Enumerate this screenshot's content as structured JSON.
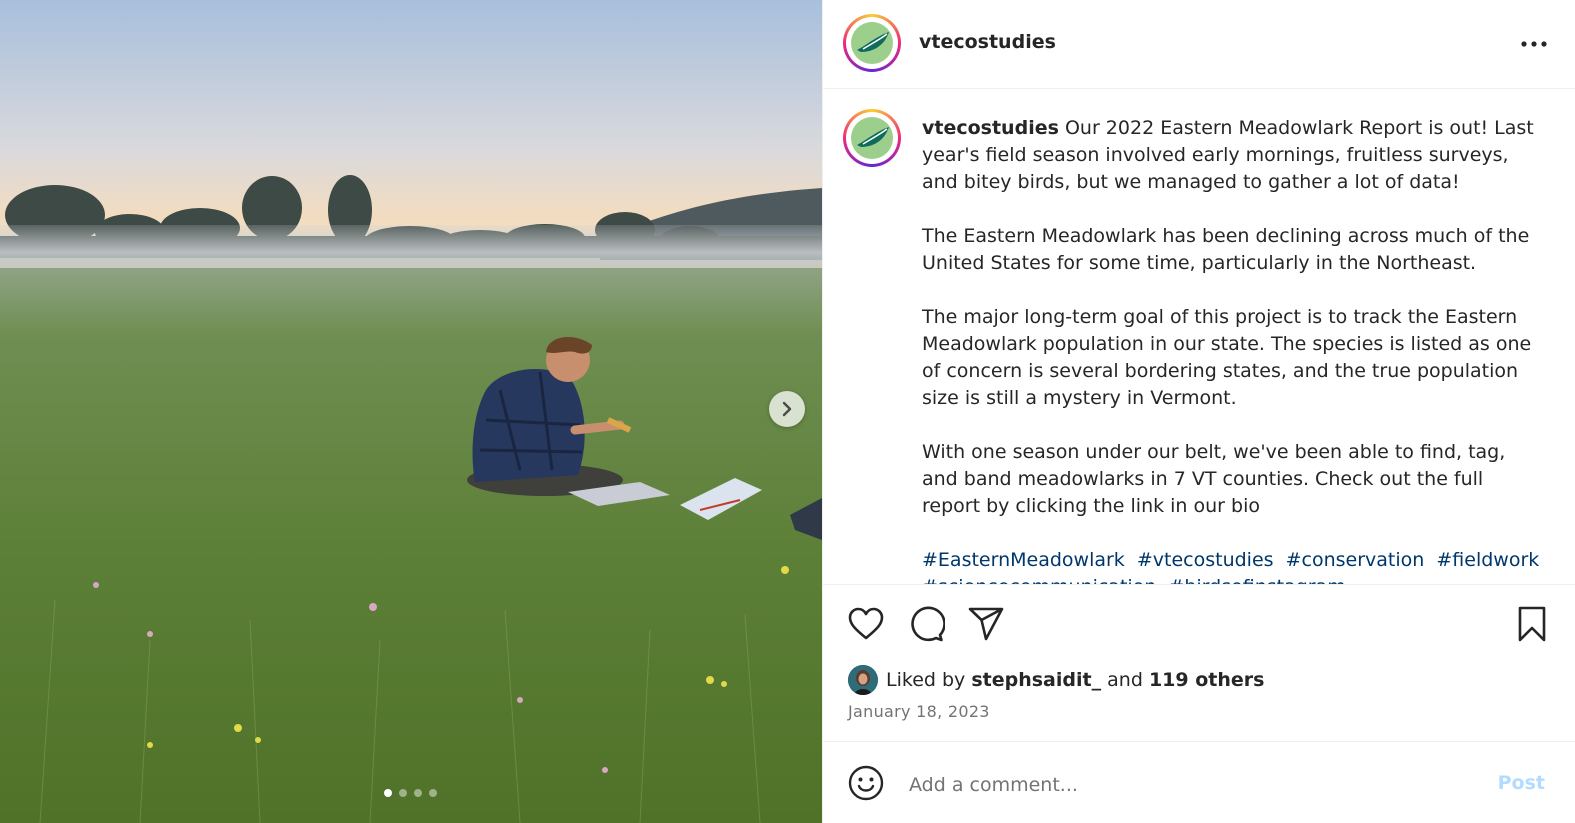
{
  "post": {
    "username": "vtecostudies",
    "caption": {
      "username": "vtecostudies",
      "paragraphs": [
        "Our 2022 Eastern Meadowlark Report is out! Last year's field season involved early mornings, fruitless surveys, and bitey birds, but we managed to gather a lot of data!",
        "The Eastern Meadowlark has been declining across much of the United States for some time, particularly in the Northeast.",
        "The major long-term goal of this project is to track the Eastern Meadowlark population in our state. The species is listed as one of concern is several bordering states, and the true population size is still a mystery in Vermont.",
        "With one season under our belt, we've been able to find, tag, and band meadowlarks in 7 VT counties. Check out the full report by clicking the link in our bio"
      ],
      "hashtags": [
        "#EasternMeadowlark",
        "#vtecostudies",
        "#conservation",
        "#fieldwork",
        "#sciencecommunication",
        "#birdsofinstagram"
      ]
    },
    "likes": {
      "prefix": "Liked by",
      "liker": "stephsaidit_",
      "middle": "and",
      "others": "119 others"
    },
    "date": "January 18, 2023",
    "carousel": {
      "count": 4,
      "active_index": 0
    }
  },
  "comment": {
    "placeholder": "Add a comment...",
    "post_label": "Post"
  },
  "icons": {
    "more": "more-horizontal-icon",
    "like": "heart-icon",
    "comment": "comment-icon",
    "share": "share-icon",
    "save": "bookmark-icon",
    "emoji": "emoji-icon",
    "next": "chevron-right-icon"
  },
  "colors": {
    "hashtag": "#00376b",
    "post_button_disabled": "#b3dbff",
    "muted_text": "#737373"
  }
}
